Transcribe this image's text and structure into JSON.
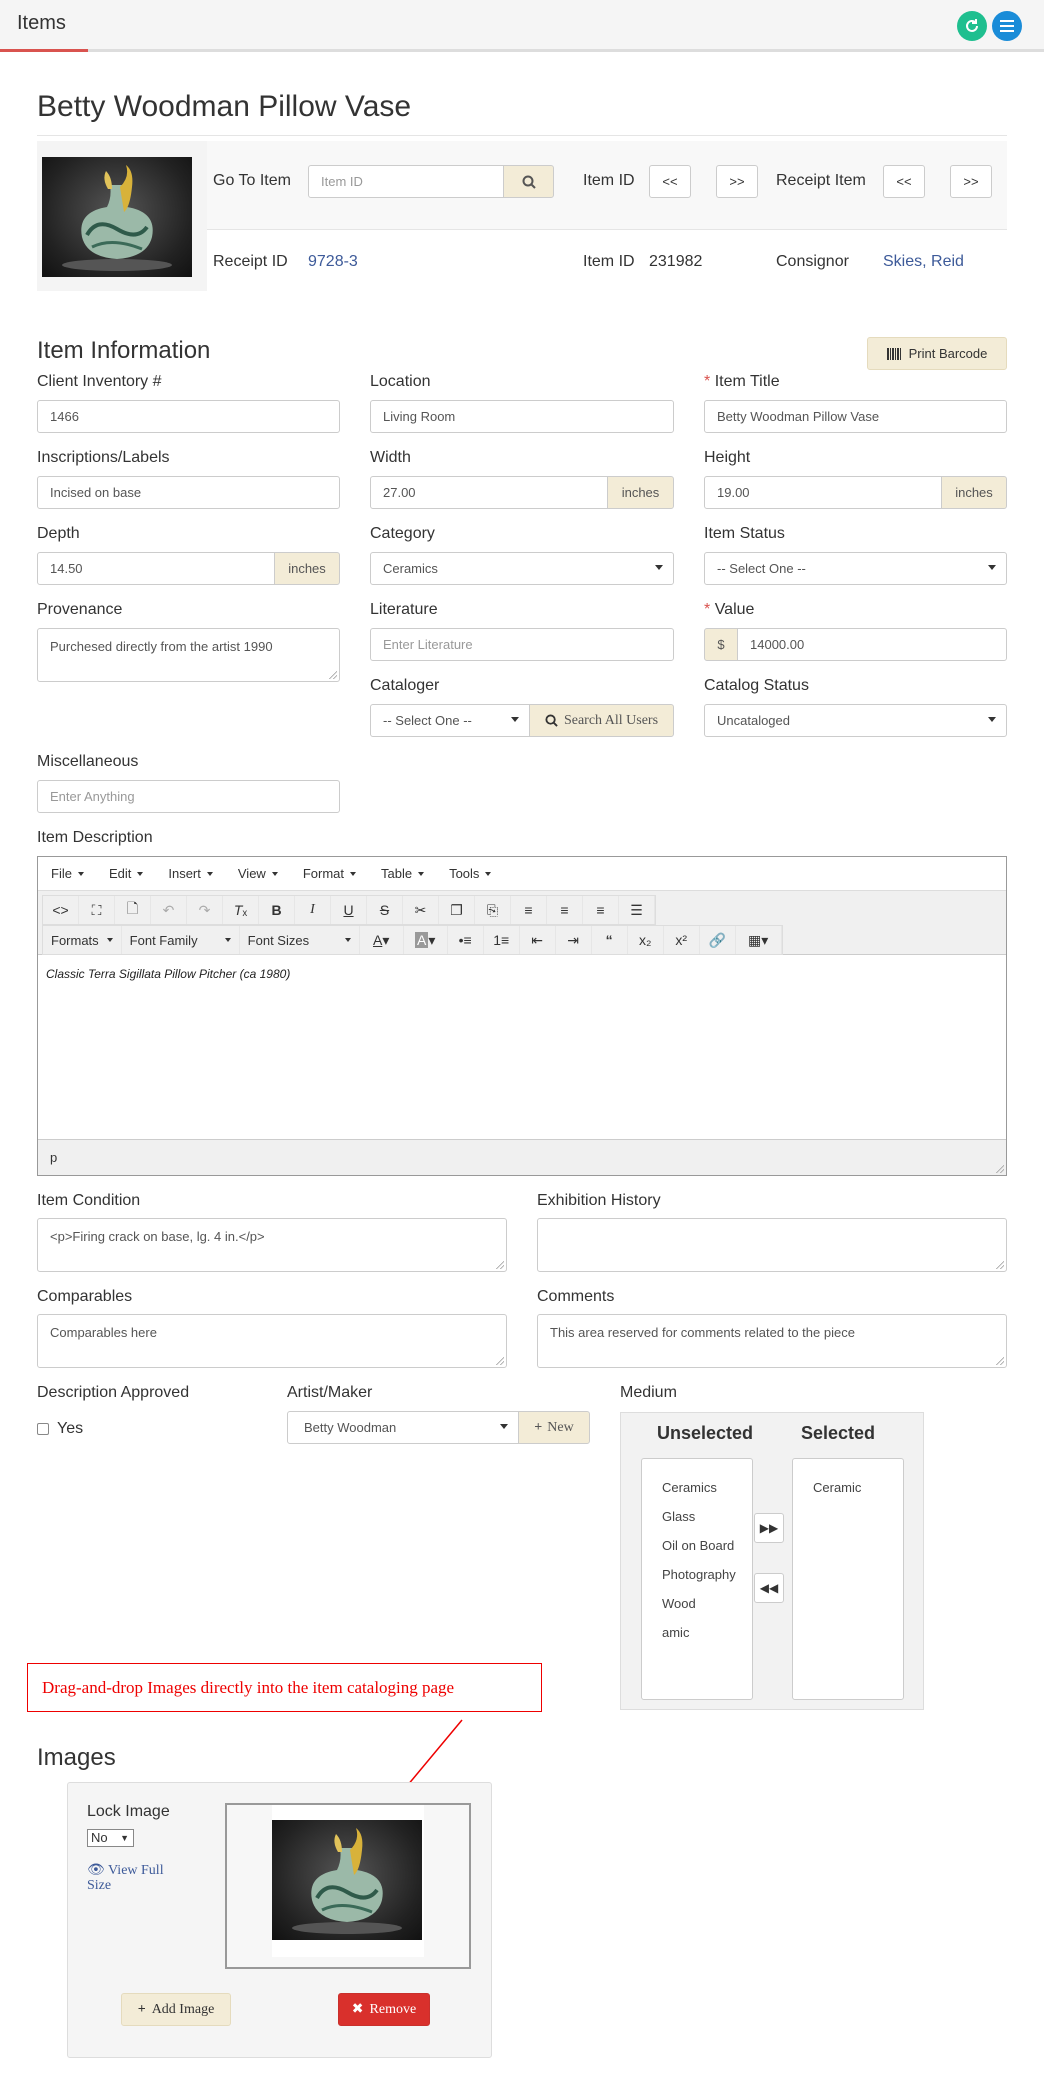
{
  "app": {
    "title": "Items"
  },
  "page": {
    "title": "Betty Woodman Pillow Vase"
  },
  "nav": {
    "goto_label": "Go To Item",
    "goto_placeholder": "Item ID",
    "item_id_label": "Item ID",
    "prev": "<<",
    "next": ">>",
    "receipt_item_label": "Receipt Item"
  },
  "summary": {
    "receipt_id_label": "Receipt ID",
    "receipt_id": "9728-3",
    "item_id_label": "Item ID",
    "item_id": "231982",
    "consignor_label": "Consignor",
    "consignor": "Skies, Reid"
  },
  "item_info": {
    "heading": "Item Information",
    "print_barcode": "Print Barcode",
    "client_inventory_label": "Client Inventory #",
    "client_inventory": "1466",
    "location_label": "Location",
    "location": "Living Room",
    "item_title_label": "Item Title",
    "item_title": "Betty Woodman Pillow Vase",
    "inscriptions_label": "Inscriptions/Labels",
    "inscriptions": "Incised on base",
    "width_label": "Width",
    "width": "27.00",
    "height_label": "Height",
    "height": "19.00",
    "unit": "inches",
    "depth_label": "Depth",
    "depth": "14.50",
    "category_label": "Category",
    "category": "Ceramics",
    "item_status_label": "Item Status",
    "item_status": "-- Select One --",
    "provenance_label": "Provenance",
    "provenance": "Purchesed directly from the artist 1990",
    "literature_label": "Literature",
    "literature_placeholder": "Enter Literature",
    "value_label": "Value",
    "value_currency": "$",
    "value": "14000.00",
    "cataloger_label": "Cataloger",
    "cataloger": "-- Select One --",
    "search_all_users": "Search All Users",
    "catalog_status_label": "Catalog Status",
    "catalog_status": "Uncataloged",
    "misc_label": "Miscellaneous",
    "misc_placeholder": "Enter Anything",
    "required_mark": "*"
  },
  "description": {
    "label": "Item Description",
    "menus": [
      "File",
      "Edit",
      "Insert",
      "View",
      "Format",
      "Table",
      "Tools"
    ],
    "dropdowns": {
      "formats": "Formats",
      "font_family": "Font Family",
      "font_sizes": "Font Sizes"
    },
    "content": "Classic Terra Sigillata Pillow Pitcher (ca 1980)",
    "status_path": "p"
  },
  "condition": {
    "label": "Item Condition",
    "value": "<p>Firing crack on base, lg. 4 in.</p>",
    "exhibition_label": "Exhibition History",
    "comparables_label": "Comparables",
    "comparables": "Comparables here",
    "comments_label": "Comments",
    "comments": "This area reserved for comments related to the piece"
  },
  "approval": {
    "label": "Description Approved",
    "yes": "Yes",
    "artist_label": "Artist/Maker",
    "artist": "Betty Woodman",
    "new_button": "New"
  },
  "medium": {
    "label": "Medium",
    "unselected_heading": "Unselected",
    "selected_heading": "Selected",
    "unselected": [
      "Ceramics",
      "Glass",
      "Oil on Board",
      "Photography",
      "Wood",
      "amic"
    ],
    "selected": [
      "Ceramic"
    ]
  },
  "callout": {
    "text": "Drag-and-drop Images directly into the item cataloging page"
  },
  "images": {
    "heading": "Images",
    "lock_label": "Lock Image",
    "lock_value": "No",
    "view_full": "View Full Size",
    "add_image": "Add Image",
    "remove": "Remove"
  },
  "colors": {
    "accent_link": "#3d5a99",
    "tan": "#f3ecd7",
    "danger": "#d9302c",
    "refresh_green": "#1fbf8f",
    "menu_blue": "#1a8cd8"
  }
}
